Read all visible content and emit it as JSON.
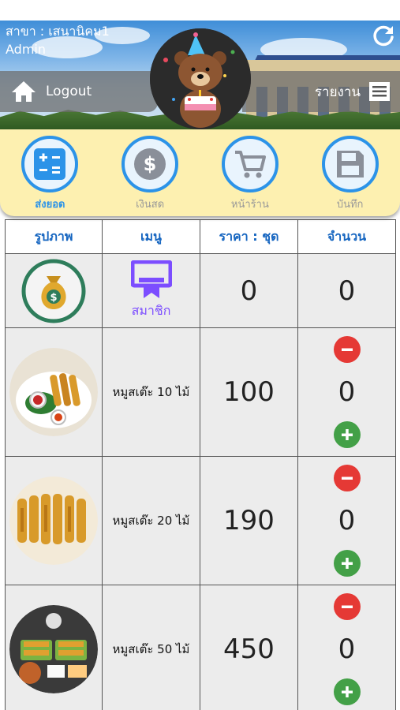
{
  "header": {
    "branch": "สาขา : เสนานิคม1",
    "user": "Admin",
    "logout_label": "Logout",
    "report_label": "รายงาน"
  },
  "actions": [
    {
      "label": "ส่งยอด",
      "icon": "calculator-icon",
      "active": true
    },
    {
      "label": "เงินสด",
      "icon": "dollar-coin-icon",
      "active": false
    },
    {
      "label": "หน้าร้าน",
      "icon": "cart-icon",
      "active": false
    },
    {
      "label": "บันทึก",
      "icon": "floppy-save-icon",
      "active": false
    }
  ],
  "table": {
    "columns": [
      "รูปภาพ",
      "เมนู",
      "ราคา : ชุด",
      "จำนวน"
    ],
    "member_row": {
      "label": "สมาชิก",
      "price": "0",
      "qty": "0"
    },
    "items": [
      {
        "name": "หมูสเต๊ะ 10 ไม้",
        "price": "100",
        "qty": "0"
      },
      {
        "name": "หมูสเต๊ะ 20 ไม้",
        "price": "190",
        "qty": "0"
      },
      {
        "name": "หมูสเต๊ะ 50 ไม้",
        "price": "450",
        "qty": "0"
      }
    ]
  },
  "colors": {
    "accent_blue": "#2c93e8",
    "action_bar_bg": "#fdf0b0",
    "minus_red": "#e53935",
    "plus_green": "#43a047",
    "member_purple": "#7c4dff"
  }
}
